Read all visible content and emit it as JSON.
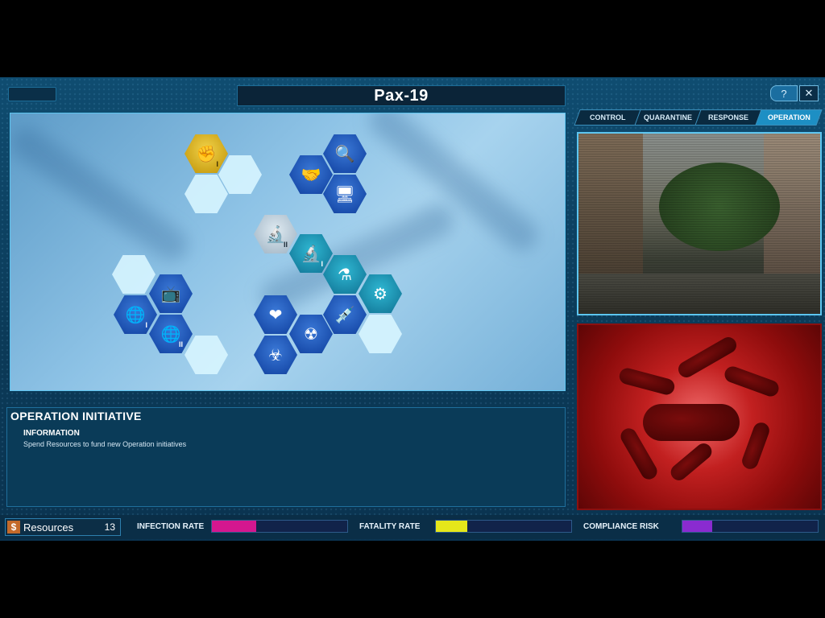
{
  "header": {
    "title": "Pax-19",
    "help_icon": "help-icon",
    "close_icon": "close-icon"
  },
  "tabs": [
    {
      "label": "CONTROL",
      "active": false
    },
    {
      "label": "QUARANTINE",
      "active": false
    },
    {
      "label": "RESPONSE",
      "active": false
    },
    {
      "label": "OPERATION",
      "active": true
    }
  ],
  "operation": {
    "title": "OPERATION INITIATIVE",
    "info_heading": "INFORMATION",
    "info_text": "Spend Resources to fund new Operation initiatives"
  },
  "tech_tree": {
    "nodes": [
      {
        "icon": "fist-icon",
        "glyph": "✊",
        "level": "I",
        "state": "gold"
      },
      {
        "icon": "magnifier-icon",
        "glyph": "🔍",
        "state": "filled"
      },
      {
        "icon": "handshake-icon",
        "glyph": "🤝",
        "state": "filled"
      },
      {
        "icon": "computer-icon",
        "glyph": "🖥",
        "state": "filled"
      },
      {
        "icon": "microscope-icon",
        "glyph": "🔬",
        "level": "II",
        "state": "grey"
      },
      {
        "icon": "microscope-icon",
        "glyph": "🔬",
        "level": "I",
        "state": "teal"
      },
      {
        "icon": "flask-icon",
        "glyph": "⚗",
        "state": "teal"
      },
      {
        "icon": "flask-gear-icon",
        "glyph": "⚙",
        "state": "teal"
      },
      {
        "icon": "no-tv-icon",
        "glyph": "📺",
        "state": "filled"
      },
      {
        "icon": "globe-people-icon",
        "glyph": "🌐",
        "level": "I",
        "state": "filled"
      },
      {
        "icon": "globe-people-icon",
        "glyph": "🌐",
        "level": "II",
        "state": "filled"
      },
      {
        "icon": "heart-icon",
        "glyph": "❤",
        "state": "filled"
      },
      {
        "icon": "syringe-icon",
        "glyph": "💉",
        "state": "filled"
      },
      {
        "icon": "gas-mask-icon",
        "glyph": "☢",
        "state": "filled"
      },
      {
        "icon": "biohazard-icon",
        "glyph": "☣",
        "state": "filled"
      }
    ]
  },
  "status_bar": {
    "resources_label": "Resources",
    "resources_value": "13",
    "infection_label": "INFECTION RATE",
    "infection_fill": 0.33,
    "infection_color": "#d4178f",
    "fatality_label": "FATALITY RATE",
    "fatality_fill": 0.23,
    "fatality_color": "#e5e71a",
    "compliance_label": "COMPLIANCE RISK",
    "compliance_fill": 0.22,
    "compliance_color": "#8a2bd0"
  }
}
